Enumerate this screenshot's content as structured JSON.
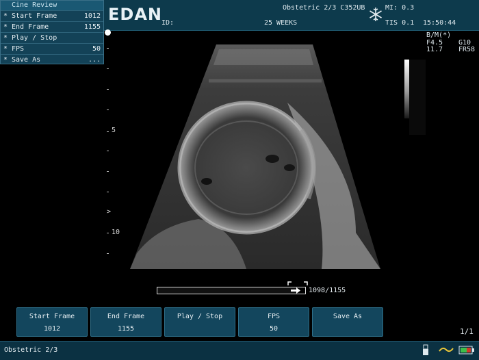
{
  "menu": {
    "title": "Cine Review",
    "items": [
      {
        "marker": "*",
        "label": "Start Frame",
        "value": "1012"
      },
      {
        "marker": "*",
        "label": "End Frame",
        "value": "1155"
      },
      {
        "marker": "*",
        "label": "Play / Stop",
        "value": ""
      },
      {
        "marker": "*",
        "label": "FPS",
        "value": "50"
      },
      {
        "marker": "*",
        "label": "Save As",
        "value": "..."
      }
    ]
  },
  "header": {
    "brand": "EDAN",
    "id_label": "ID:",
    "exam_probe": "Obstetric 2/3 C352UB",
    "gestation": "25 WEEKS",
    "mi": "MI: 0.3",
    "tis": "TIS 0.1",
    "time": "15:50:44",
    "freeze_icon": "snowflake-icon"
  },
  "image_params": {
    "mode": "B/M(*)",
    "freq": "F4.5",
    "gain": "G10",
    "depth": "11.7",
    "frame_rate": "FR58"
  },
  "depth_scale": {
    "labels": [
      "5",
      "10"
    ],
    "focus_marker": ">"
  },
  "cine": {
    "counter": "1098/1155",
    "current_frame": 1098,
    "total_frames": 1155
  },
  "softkeys": [
    {
      "label": "Start Frame",
      "value": "1012"
    },
    {
      "label": "End Frame",
      "value": "1155"
    },
    {
      "label": "Play / Stop",
      "value": ""
    },
    {
      "label": "FPS",
      "value": "50"
    },
    {
      "label": "Save As",
      "value": ""
    }
  ],
  "page_indicator": "1/1",
  "status_bar": {
    "exam": "Obstetric 2/3",
    "icons": [
      "usb-icon",
      "wave-icon",
      "battery-icon"
    ]
  },
  "colors": {
    "panel": "#13465d",
    "header": "#0d3a4c",
    "wave_icon": "#e8c53a"
  }
}
